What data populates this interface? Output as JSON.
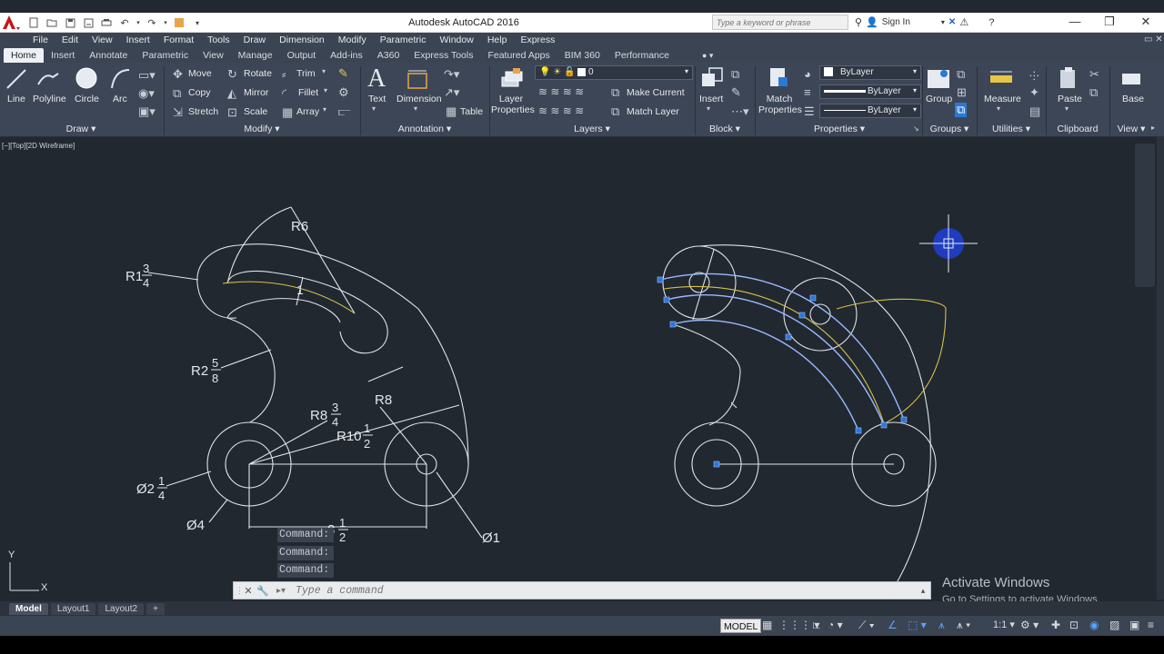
{
  "app": {
    "title": "Autodesk AutoCAD 2016",
    "search_placeholder": "Type a keyword or phrase",
    "sign_in": "Sign In"
  },
  "menu": [
    "File",
    "Edit",
    "View",
    "Insert",
    "Format",
    "Tools",
    "Draw",
    "Dimension",
    "Modify",
    "Parametric",
    "Window",
    "Help",
    "Express"
  ],
  "ribbon_tabs": [
    "Home",
    "Insert",
    "Annotate",
    "Parametric",
    "View",
    "Manage",
    "Output",
    "Add-ins",
    "A360",
    "Express Tools",
    "Featured Apps",
    "BIM 360",
    "Performance"
  ],
  "ribbon": {
    "draw": {
      "line": "Line",
      "polyline": "Polyline",
      "circle": "Circle",
      "arc": "Arc",
      "panel": "Draw"
    },
    "modify": {
      "move": "Move",
      "rotate": "Rotate",
      "trim": "Trim",
      "copy": "Copy",
      "mirror": "Mirror",
      "fillet": "Fillet",
      "stretch": "Stretch",
      "scale": "Scale",
      "array": "Array",
      "panel": "Modify"
    },
    "annotation": {
      "text": "Text",
      "dimension": "Dimension",
      "table": "Table",
      "panel": "Annotation"
    },
    "layers": {
      "layer_properties": "Layer Properties",
      "current_layer": "0",
      "make_current": "Make Current",
      "match_layer": "Match Layer",
      "panel": "Layers"
    },
    "block": {
      "insert": "Insert",
      "panel": "Block"
    },
    "properties": {
      "match_properties": "Match Properties",
      "color": "ByLayer",
      "linetype": "ByLayer",
      "lineweight": "ByLayer",
      "panel": "Properties"
    },
    "groups": {
      "group": "Group",
      "panel": "Groups"
    },
    "utilities": {
      "measure": "Measure",
      "panel": "Utilities"
    },
    "clipboard": {
      "paste": "Paste",
      "panel": "Clipboard"
    },
    "view": {
      "base": "Base",
      "panel": "View"
    }
  },
  "viewport": {
    "label": "[−][Top][2D Wireframe]"
  },
  "drawing": {
    "dims": {
      "r6": "R6",
      "r1_whole": "R1",
      "r1_num": "3",
      "r1_den": "4",
      "r2_whole": "R2",
      "r2_num": "5",
      "r2_den": "8",
      "r8": "R8",
      "r8_whole": "R8",
      "r8_num": "3",
      "r8_den": "4",
      "r10_whole": "R10",
      "r10_num": "1",
      "r10_den": "2",
      "d2_whole": "Ø2",
      "d2_num": "1",
      "d2_den": "4",
      "d4": "Ø4",
      "d1": "Ø1",
      "len_whole": "8",
      "len_num": "1",
      "len_den": "2",
      "one": "1"
    },
    "ucs": {
      "x": "X",
      "y": "Y"
    }
  },
  "command": {
    "history": [
      "Command:",
      "Command:",
      "Command:"
    ],
    "placeholder": "Type a command"
  },
  "watermark": {
    "line1": "Activate Windows",
    "line2": "Go to Settings to activate Windows."
  },
  "layout_tabs": [
    "Model",
    "Layout1",
    "Layout2"
  ],
  "status": {
    "model": "MODEL",
    "scale": "1:1"
  },
  "colors": {
    "background": "#212830",
    "ribbon": "#3d4656",
    "grip": "#2a78d8",
    "selection": "#9ab9ff",
    "centerline": "#d4c04a"
  }
}
